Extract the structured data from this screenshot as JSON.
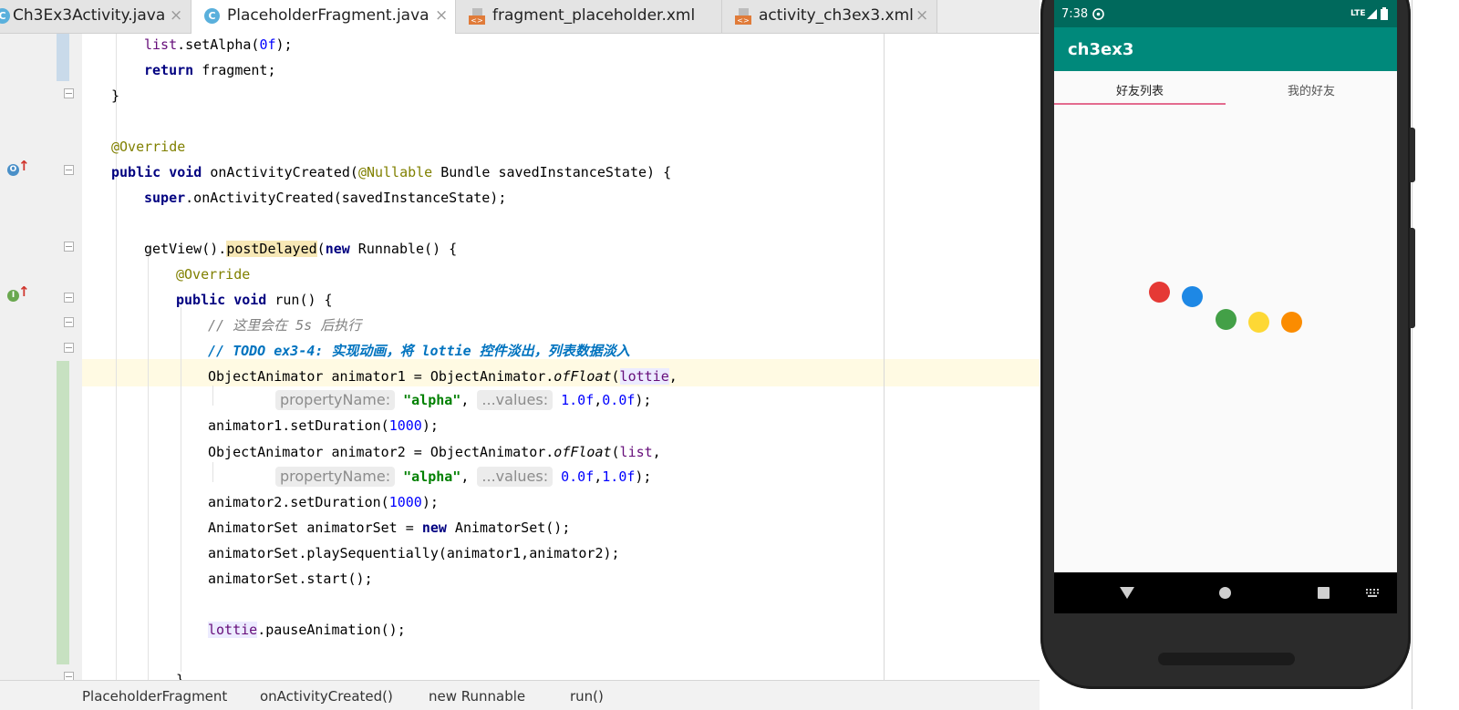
{
  "tabs": [
    {
      "label": "Ch3Ex3Activity.java",
      "icon": "java-class-icon"
    },
    {
      "label": "PlaceholderFragment.java",
      "icon": "java-class-icon",
      "active": true
    },
    {
      "label": "fragment_placeholder.xml",
      "icon": "xml-layout-icon"
    },
    {
      "label": "activity_ch3ex3.xml",
      "icon": "xml-layout-icon"
    }
  ],
  "close_glyph": "×",
  "code": {
    "l01a": "list",
    "l01b": ".setAlpha(",
    "l01c": "0f",
    "l01d": ");",
    "l02a": "return",
    "l02b": " fragment;",
    "l03": "}",
    "l05": "@Override",
    "l06a": "public void",
    "l06b": " onActivityCreated(",
    "l06c": "@Nullable",
    "l06d": " Bundle savedInstanceState) {",
    "l07a": "super",
    "l07b": ".onActivityCreated(savedInstanceState);",
    "l09a": "getView().",
    "l09b": "postDelayed",
    "l09c": "(",
    "l09d": "new",
    "l09e": " Runnable() {",
    "l10": "@Override",
    "l11a": "public void",
    "l11b": " run() {",
    "l12": "// 这里会在 5s 后执行",
    "l13": "// TODO ex3-4: 实现动画，将 lottie 控件淡出，列表数据淡入",
    "l14a": "ObjectAnimator animator1 = ObjectAnimator.",
    "l14b": "ofFloat",
    "l14c": "(",
    "l14d": "lottie",
    "l14e": ",",
    "hint_prop": "propertyName:",
    "hint_vals": "...values:",
    "str_alpha": "\"alpha\"",
    "l15a": "1.0f",
    "l15b": "0.0f",
    "l16a": "animator1.setDuration(",
    "l16b": "1000",
    "l16c": ");",
    "l17a": "ObjectAnimator animator2 = ObjectAnimator.",
    "l17b": "ofFloat",
    "l17c": "(",
    "l17d": "list",
    "l17e": ",",
    "l18a": "0.0f",
    "l18b": "1.0f",
    "l19a": "animator2.setDuration(",
    "l19b": "1000",
    "l19c": ");",
    "l20a": "AnimatorSet animatorSet = ",
    "l20b": "new",
    "l20c": " AnimatorSet();",
    "l21": "animatorSet.playSequentially(animator1,animator2);",
    "l22": "animatorSet.start();",
    "l24a": "lottie",
    "l24b": ".pauseAnimation();",
    "l26": "}"
  },
  "gutter_icons": {
    "override1": "O",
    "override2": "I"
  },
  "statusbar": {
    "class_crumb": "PlaceholderFragment",
    "method_crumb": "onActivityCreated()",
    "inner_crumb": "new Runnable",
    "run_crumb": "run()"
  },
  "phone": {
    "time": "7:38",
    "network": "LTE",
    "app_title": "ch3ex3",
    "tab1": "好友列表",
    "tab2": "我的好友",
    "dot_colors": [
      "#e53935",
      "#1e88e5",
      "#43a047",
      "#fdd835",
      "#fb8c00"
    ],
    "accent": "#00897b",
    "status_color": "#00695c",
    "indicator_color": "#e36b8f"
  }
}
